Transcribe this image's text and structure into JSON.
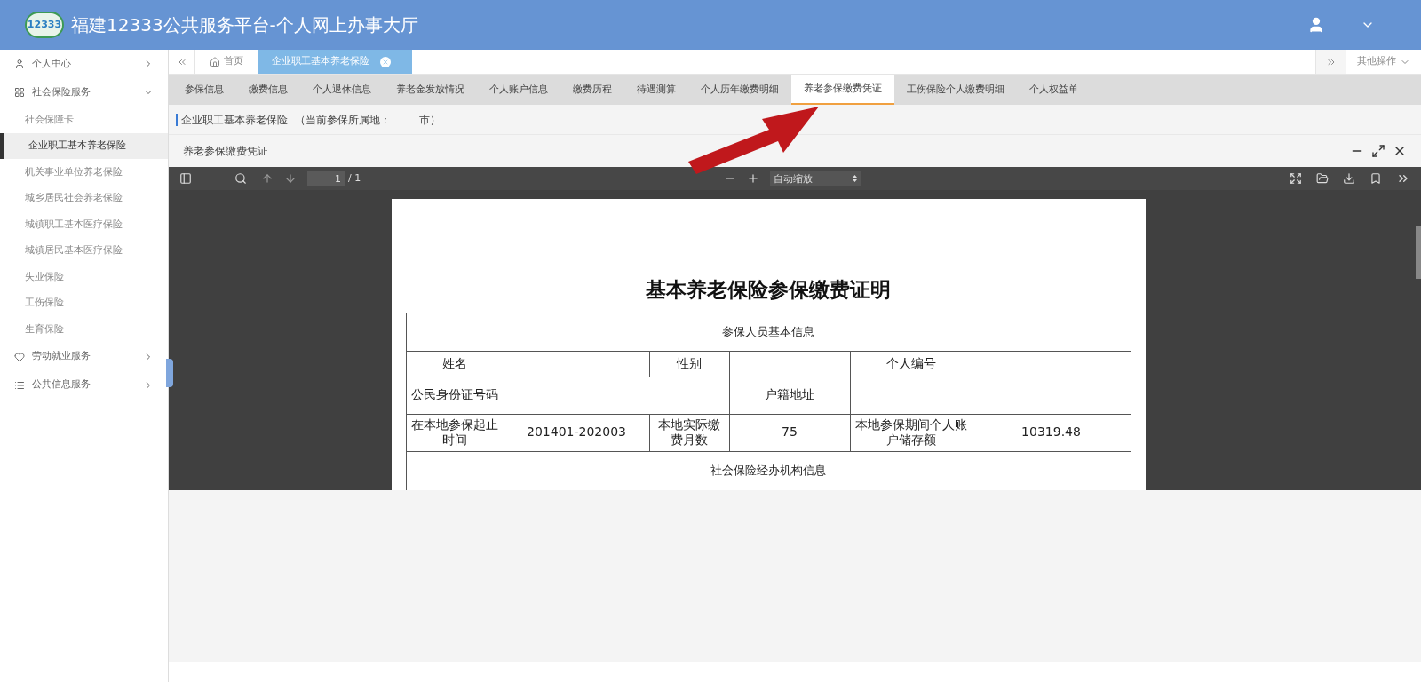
{
  "header": {
    "title": "福建12333公共服务平台-个人网上办事大厅",
    "logo": "12333"
  },
  "sidebar": {
    "items": [
      {
        "label": "个人中心",
        "expanded": false
      },
      {
        "label": "社会保险服务",
        "expanded": true,
        "children": [
          {
            "label": "社会保障卡",
            "selected": false
          },
          {
            "label": "企业职工基本养老保险",
            "selected": true
          },
          {
            "label": "机关事业单位养老保险",
            "selected": false
          },
          {
            "label": "城乡居民社会养老保险",
            "selected": false
          },
          {
            "label": "城镇职工基本医疗保险",
            "selected": false
          },
          {
            "label": "城镇居民基本医疗保险",
            "selected": false
          },
          {
            "label": "失业保险",
            "selected": false
          },
          {
            "label": "工伤保险",
            "selected": false
          },
          {
            "label": "生育保险",
            "selected": false
          }
        ]
      },
      {
        "label": "劳动就业服务",
        "expanded": false
      },
      {
        "label": "公共信息服务",
        "expanded": false
      }
    ]
  },
  "page_tabs": [
    {
      "label": "首页",
      "selected": false
    },
    {
      "label": "企业职工基本养老保险",
      "selected": true
    }
  ],
  "other_ops": "其他操作",
  "sub_tabs": [
    {
      "label": "参保信息",
      "selected": false
    },
    {
      "label": "缴费信息",
      "selected": false
    },
    {
      "label": "个人退休信息",
      "selected": false
    },
    {
      "label": "养老金发放情况",
      "selected": false
    },
    {
      "label": "个人账户信息",
      "selected": false
    },
    {
      "label": "缴费历程",
      "selected": false
    },
    {
      "label": "待遇测算",
      "selected": false
    },
    {
      "label": "个人历年缴费明细",
      "selected": false
    },
    {
      "label": "养老参保缴费凭证",
      "selected": true
    },
    {
      "label": "工伤保险个人缴费明细",
      "selected": false
    },
    {
      "label": "个人权益单",
      "selected": false
    }
  ],
  "breadcrumb": [
    "企业职工基本养老保险",
    "（当前参保所属地：",
    "市）"
  ],
  "panel_title": "养老参保缴费凭证",
  "pdf_toolbar": {
    "page": "1",
    "page_count": "/ 1",
    "zoom": "自动缩放"
  },
  "document": {
    "title": "基本养老保险参保缴费证明",
    "section_1": "参保人员基本信息",
    "row_1": [
      "姓名",
      "性别",
      "个人编号"
    ],
    "row_2": [
      "公民身份证号码",
      "户籍地址"
    ],
    "row_3": [
      "在本地参保起止时间",
      "201401-202003",
      "本地实际缴费月数",
      "75",
      "本地参保期间个人账户储存额",
      "10319.48"
    ],
    "section_2": "社会保险经办机构信息"
  }
}
